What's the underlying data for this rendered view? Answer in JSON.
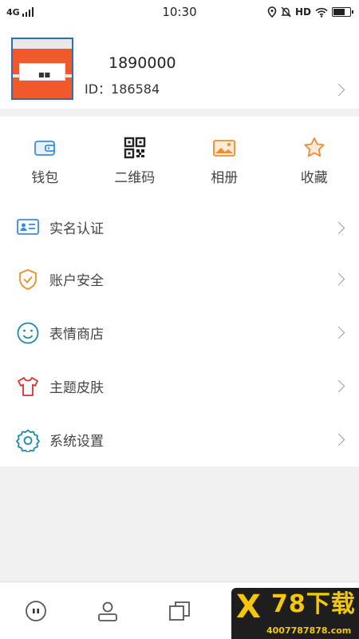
{
  "status_bar": {
    "network": "4G",
    "time": "10:30",
    "hd": "HD"
  },
  "profile": {
    "name": "1890000",
    "id_text": "ID：186584"
  },
  "quick_actions": [
    {
      "label": "钱包",
      "icon": "wallet-icon"
    },
    {
      "label": "二维码",
      "icon": "qr-code-icon"
    },
    {
      "label": "相册",
      "icon": "photo-album-icon"
    },
    {
      "label": "收藏",
      "icon": "star-icon"
    }
  ],
  "menu": [
    {
      "label": "实名认证",
      "icon": "id-card-icon"
    },
    {
      "label": "账户安全",
      "icon": "shield-icon"
    },
    {
      "label": "表情商店",
      "icon": "smiley-icon"
    },
    {
      "label": "主题皮肤",
      "icon": "tshirt-icon"
    },
    {
      "label": "系统设置",
      "icon": "gear-icon"
    }
  ],
  "tabbar": [
    "chat-icon",
    "contacts-icon",
    "discover-icon",
    "navigate-icon",
    "me-icon"
  ],
  "watermark": {
    "brand": "78下载",
    "url": "4007787878.com"
  },
  "colors": {
    "blue": "#3a8dde",
    "orange": "#f28c28",
    "teal": "#1e88a8",
    "red": "#d9322e",
    "brand_yellow": "#f5c70a"
  }
}
